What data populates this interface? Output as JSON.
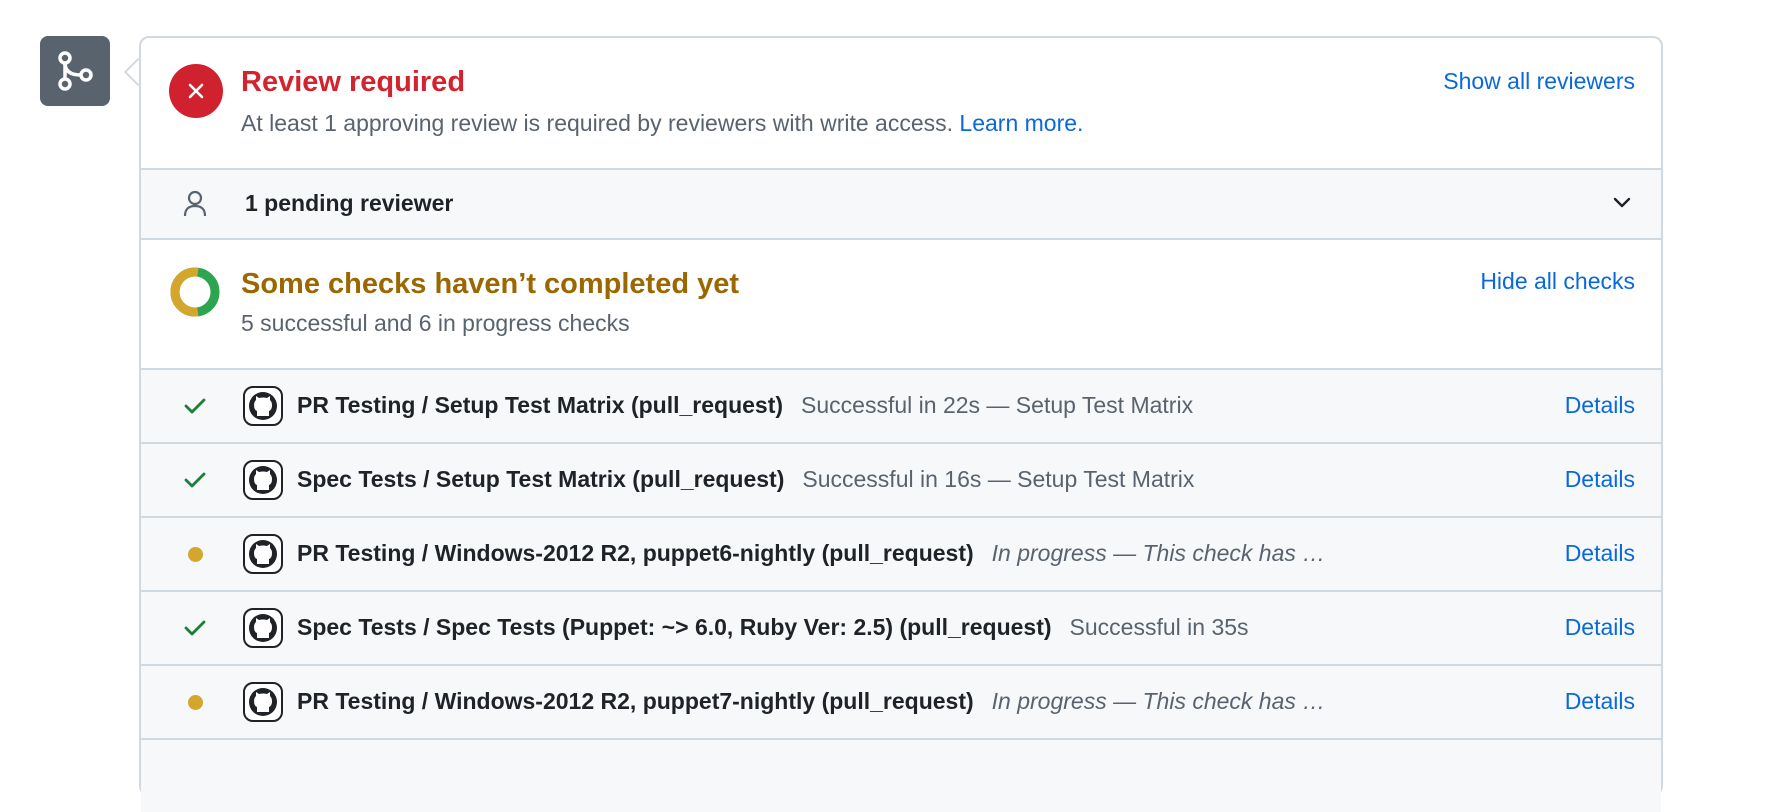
{
  "merge_box": {
    "icon": "git-merge-icon"
  },
  "review": {
    "title": "Review required",
    "description": "At least 1 approving review is required by reviewers with write access.",
    "learn_more": "Learn more.",
    "show_all": "Show all reviewers",
    "icon": "x-circle-icon",
    "color": "#d1242f"
  },
  "pending": {
    "label": "1 pending reviewer",
    "icon": "person-icon",
    "toggle_icon": "chevron-down-icon"
  },
  "checks": {
    "title": "Some checks haven’t completed yet",
    "summary": "5 successful and 6 in progress checks",
    "hide_all": "Hide all checks",
    "title_color": "#9a6700",
    "progress": {
      "successful": 5,
      "in_progress": 6
    },
    "items": [
      {
        "status": "success",
        "name": "PR Testing / Setup Test Matrix (pull_request)",
        "description": "Successful in 22s — Setup Test Matrix",
        "details": "Details"
      },
      {
        "status": "success",
        "name": "Spec Tests / Setup Test Matrix (pull_request)",
        "description": "Successful in 16s — Setup Test Matrix",
        "details": "Details"
      },
      {
        "status": "in_progress",
        "name": "PR Testing / Windows-2012 R2, puppet6-nightly (pull_request)",
        "description": "In progress — This check has …",
        "details": "Details"
      },
      {
        "status": "success",
        "name": "Spec Tests / Spec Tests (Puppet: ~> 6.0, Ruby Ver: 2.5) (pull_request)",
        "description": "Successful in 35s",
        "details": "Details"
      },
      {
        "status": "in_progress",
        "name": "PR Testing / Windows-2012 R2, puppet7-nightly (pull_request)",
        "description": "In progress — This check has …",
        "details": "Details"
      }
    ]
  },
  "colors": {
    "accent": "#0969da",
    "success": "#1a7f37",
    "pending": "#d4a72c",
    "danger": "#cf222e"
  }
}
